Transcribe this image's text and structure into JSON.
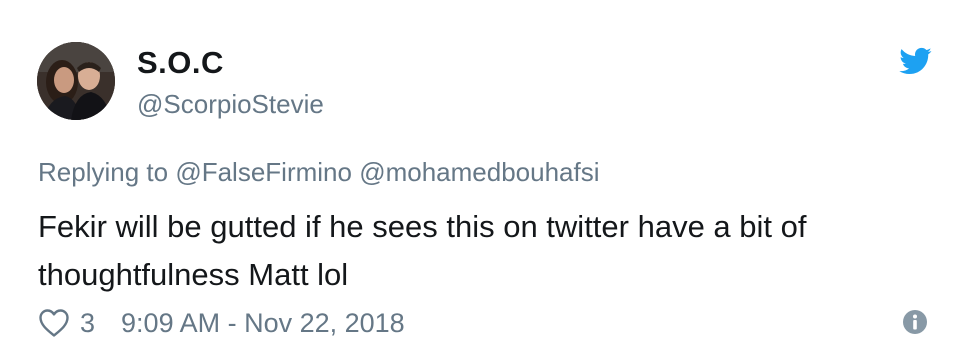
{
  "user": {
    "display_name": "S.O.C",
    "handle": "@ScorpioStevie"
  },
  "reply": {
    "prefix": "Replying to",
    "mentions": [
      "@FalseFirmino",
      "@mohamedbouhafsi"
    ]
  },
  "tweet": {
    "text_line1": "Fekir will be gutted if he sees this on twitter have a bit of",
    "text_line2": "thoughtfulness Matt lol"
  },
  "footer": {
    "like_count": "3",
    "timestamp": "9:09 AM - Nov 22, 2018"
  },
  "icons": {
    "brand": "twitter-bird-icon",
    "like": "heart-icon",
    "info": "info-icon"
  },
  "colors": {
    "twitter_blue": "#1da1f2",
    "text_primary": "#14171a",
    "text_secondary": "#657786"
  }
}
